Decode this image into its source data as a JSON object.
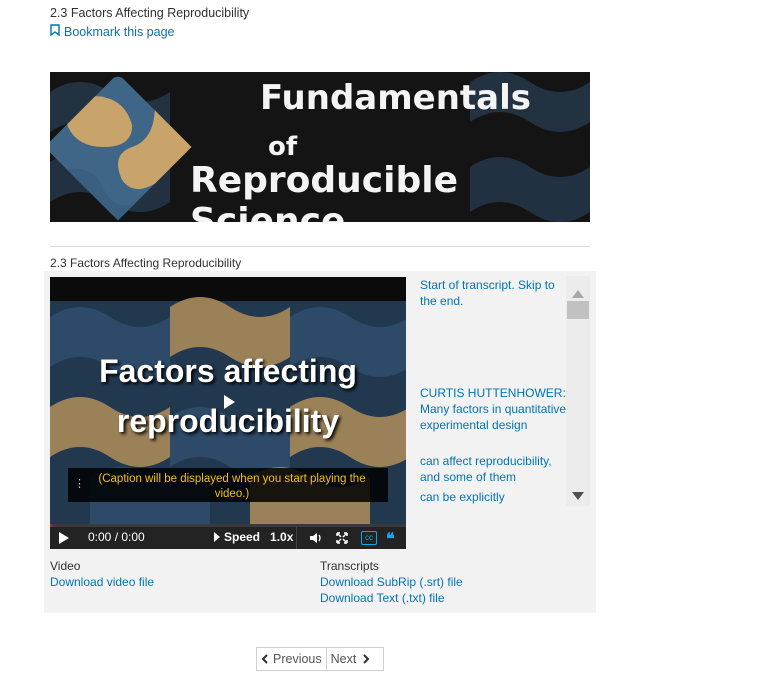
{
  "unit": {
    "title": "2.3 Factors Affecting Reproducibility",
    "bookmark_label": "Bookmark this page"
  },
  "banner": {
    "line1": "Fundamentals",
    "line2": "of",
    "line3": "Reproducible Science"
  },
  "video": {
    "heading": "2.3 Factors Affecting Reproducibility",
    "slide_title_line1": "Factors affecting",
    "slide_title_line2": "reproducibility",
    "caption": "(Caption will be displayed when you start playing the video.)",
    "time": "0:00 / 0:00",
    "speed_label": "Speed",
    "speed_value": "1.0x",
    "cc_label": "cc"
  },
  "transcript": {
    "lines": [
      "Start of transcript. Skip to the end.",
      "CURTIS HUTTENHOWER: Many factors in quantitative experimental design",
      "can affect reproducibility, and some of them",
      "can be explicitly"
    ]
  },
  "downloads": {
    "video_label": "Video",
    "video_link": "Download video file",
    "transcripts_label": "Transcripts",
    "srt_link": "Download SubRip (.srt) file",
    "txt_link": "Download Text (.txt) file"
  },
  "pager": {
    "previous": "Previous",
    "next": "Next"
  },
  "colors": {
    "link": "#0075b4",
    "caption": "#f2c30a",
    "controls_bg": "#232323",
    "cc_active": "#0ea6ec"
  }
}
